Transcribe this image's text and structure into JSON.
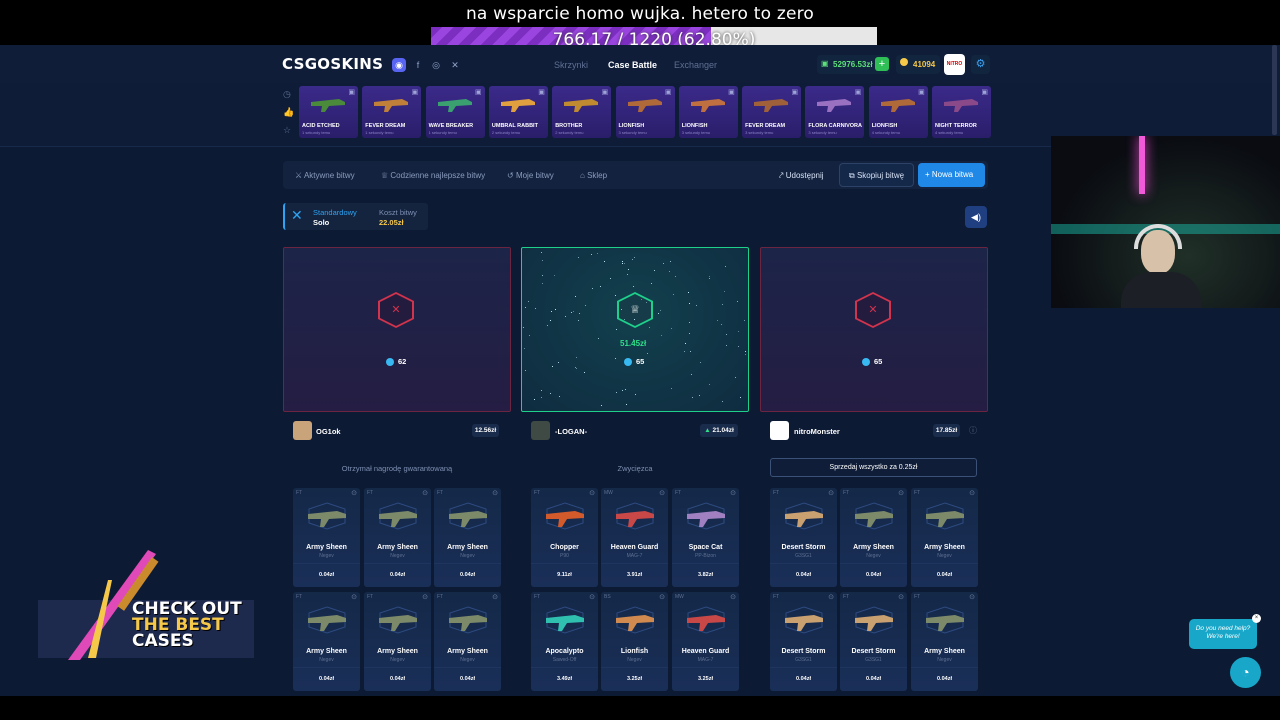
{
  "stream": {
    "title": "na wsparcie homo wujka. hetero to zero",
    "goal_text": "766.17 / 1220 (62.80%)",
    "goal_fraction": 0.628
  },
  "header": {
    "logo": "CSGOSKINS",
    "nav": [
      "Skrzynki",
      "Case Battle",
      "Exchanger"
    ],
    "balance": "52976.53zł",
    "coins": "41094",
    "avatar_text": "NITRO"
  },
  "live_drops": [
    {
      "name": "ACID ETCHED",
      "time": "1 sekundy temu"
    },
    {
      "name": "FEVER DREAM",
      "time": "1 sekundy temu"
    },
    {
      "name": "WAVE BREAKER",
      "time": "1 sekundy temu"
    },
    {
      "name": "UMBRAL RABBIT",
      "time": "2 sekundy temu"
    },
    {
      "name": "BROTHER",
      "time": "2 sekundy temu"
    },
    {
      "name": "LIONFISH",
      "time": "3 sekundy temu"
    },
    {
      "name": "LIONFISH",
      "time": "3 sekundy temu"
    },
    {
      "name": "FEVER DREAM",
      "time": "3 sekundy temu"
    },
    {
      "name": "FLORA CARNIVORA",
      "time": "3 sekundy temu"
    },
    {
      "name": "LIONFISH",
      "time": "4 sekundy temu"
    },
    {
      "name": "NIGHT TERROR",
      "time": "4 sekundy temu"
    }
  ],
  "tabs": {
    "items": [
      "Aktywne bitwy",
      "Codzienne najlepsze bitwy",
      "Moje bitwy",
      "Sklep"
    ],
    "share": "Udostępnij",
    "copy": "Skopiuj bitwę",
    "new": "+ Nowa bitwa"
  },
  "mode": {
    "label": "Standardowy",
    "value": "Solo",
    "cost_label": "Koszt bitwy",
    "cost_value": "22.05zł"
  },
  "players": [
    {
      "name": "OG1ok",
      "value": "12.56zł",
      "orbs": "62",
      "status": "Otrzymał nagrodę gwarantowaną",
      "winner": false,
      "items": [
        {
          "wear": "FT",
          "name": "Army Sheen",
          "skin": "Negev",
          "price": "0.04zł"
        },
        {
          "wear": "FT",
          "name": "Army Sheen",
          "skin": "Negev",
          "price": "0.04zł"
        },
        {
          "wear": "FT",
          "name": "Army Sheen",
          "skin": "Negev",
          "price": "0.04zł"
        },
        {
          "wear": "FT",
          "name": "Army Sheen",
          "skin": "Negev",
          "price": "0.04zł"
        },
        {
          "wear": "FT",
          "name": "Army Sheen",
          "skin": "Negev",
          "price": "0.04zł"
        },
        {
          "wear": "FT",
          "name": "Army Sheen",
          "skin": "Negev",
          "price": "0.04zł"
        }
      ]
    },
    {
      "name": "-LOGAN-",
      "value": "21.04zł",
      "orbs": "65",
      "win_amount": "51.45zł",
      "status": "Zwycięzca",
      "winner": true,
      "items": [
        {
          "wear": "FT",
          "name": "Chopper",
          "skin": "P90",
          "price": "9.11zł"
        },
        {
          "wear": "MW",
          "name": "Heaven Guard",
          "skin": "MAG-7",
          "price": "3.91zł"
        },
        {
          "wear": "FT",
          "name": "Space Cat",
          "skin": "PP-Bizon",
          "price": "3.82zł"
        },
        {
          "wear": "FT",
          "name": "Apocalypto",
          "skin": "Sawed-Off",
          "price": "3.49zł"
        },
        {
          "wear": "BS",
          "name": "Lionfish",
          "skin": "Negev",
          "price": "3.25zł"
        },
        {
          "wear": "MW",
          "name": "Heaven Guard",
          "skin": "MAG-7",
          "price": "3.25zł"
        }
      ]
    },
    {
      "name": "nitroMonster",
      "value": "17.85zł",
      "orbs": "65",
      "status": "",
      "sell_all": "Sprzedaj wszystko za 0.25zł",
      "winner": false,
      "items": [
        {
          "wear": "FT",
          "name": "Desert Storm",
          "skin": "G3SG1",
          "price": "0.04zł"
        },
        {
          "wear": "FT",
          "name": "Army Sheen",
          "skin": "Negev",
          "price": "0.04zł"
        },
        {
          "wear": "FT",
          "name": "Army Sheen",
          "skin": "Negev",
          "price": "0.04zł"
        },
        {
          "wear": "FT",
          "name": "Desert Storm",
          "skin": "G3SG1",
          "price": "0.04zł"
        },
        {
          "wear": "FT",
          "name": "Desert Storm",
          "skin": "G3SG1",
          "price": "0.04zł"
        },
        {
          "wear": "FT",
          "name": "Army Sheen",
          "skin": "Negev",
          "price": "0.04zł"
        }
      ]
    }
  ],
  "promo": {
    "line1": "CHECK OUT",
    "line2": "THE BEST",
    "line3": "CASES"
  },
  "help": {
    "bubble": "Do you need help? We're here!"
  },
  "colors": {
    "accent": "#2089e8",
    "win": "#1fd08a",
    "lose": "#d2334d",
    "gold": "#f5c84a"
  }
}
